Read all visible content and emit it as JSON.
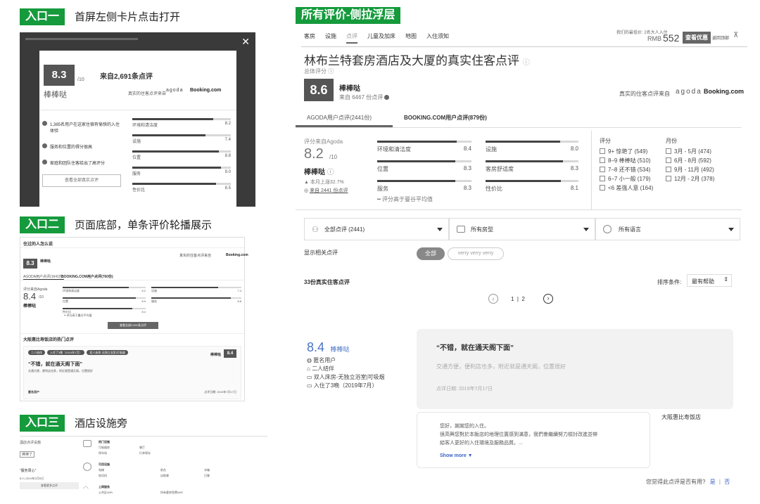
{
  "sections": {
    "s1": {
      "tag": "入口一",
      "caption": "首屏左侧卡片点击打开"
    },
    "s2": {
      "tag": "入口二",
      "caption": "页面底部，单条评价轮播展示"
    },
    "s3": {
      "tag": "入口三",
      "caption": "酒店设施旁"
    },
    "s4": {
      "tag": "所有评价-侧拉浮层"
    }
  },
  "p1": {
    "close": "✕",
    "score": "8.3",
    "outof": "/10",
    "rating": "棒棒哒",
    "reviews_from": "来自2,691条点评",
    "source_text": "真实的住客点评来自",
    "agoda": "agoda",
    "booking": "Booking.com",
    "highlights": [
      "1,385名用户在这家住宿有愉快的入住体验",
      "服务和位置的得分很高",
      "家庭和团队住客给出了高评分"
    ],
    "button": "查看全部真实点评",
    "bars": [
      {
        "label": "环境和清洁度",
        "value": "8.2",
        "pct": 82
      },
      {
        "label": "设施",
        "value": "7.4",
        "pct": 74
      },
      {
        "label": "位置",
        "value": "8.8",
        "pct": 88
      },
      {
        "label": "服务",
        "value": "9.0",
        "pct": 90
      },
      {
        "label": "性价比",
        "value": "8.5",
        "pct": 85
      }
    ]
  },
  "p2": {
    "title": "住过的人怎么说",
    "score": "8.3",
    "rating": "棒棒哒",
    "source": "真实的住客点评来自",
    "booking": "Booking.com",
    "tab1": "AGODA用户点评(1641份)",
    "tab2": "BOOKING.COM用户点评(760份)",
    "agoda_from": "评分来自Agoda",
    "score2": "8.4",
    "outof": "/10",
    "rating2": "棒棒哒",
    "bars": [
      {
        "label": "环境和清洁度",
        "value": "8.2"
      },
      {
        "label": "设施",
        "value": "7.4"
      },
      {
        "label": "位置",
        "value": "8.9"
      },
      {
        "label": "服务",
        "value": "8.8"
      },
      {
        "label": "性价比",
        "value": "8.4"
      }
    ],
    "avg_note": "━ 评分高于曼谷平均值",
    "view_all": "查看全部2,691条点评",
    "hot_title": "大阪惠比寿饭店的热门点评",
    "chips": [
      "二人结伴",
      "入住了3晚（2019年7月）",
      "双人床房-无独立浴室|可吸烟"
    ],
    "quote": "“不错，就在通天阁下面”",
    "quote_sub": "交通方便，便利店也多，附近就是通天阁，位置很好",
    "anon": "匿名用户",
    "date": "点评日期: 2019年7月17日",
    "right_rating": "棒棒哒",
    "right_score": "8.4"
  },
  "p3": {
    "head": "酒店点评设施",
    "rating": "棒棒了",
    "quote": "“服务周心”",
    "stay": "8.0 | 2019年2月9日",
    "btn": "查看更多点评",
    "cats": [
      {
        "title": "热门设施",
        "items": [
          "可吸烟房",
          "餐厅",
          "停车场",
          "行李寄存"
        ]
      },
      {
        "title": "可用设施",
        "items": [
          "电梯",
          "前台",
          "冰箱",
          "吹风机",
          "自助餐",
          "日餐"
        ]
      },
      {
        "title": "上网服务",
        "items": [
          "公共区WiFi",
          "所有客房免费WiFi"
        ]
      }
    ]
  },
  "p4": {
    "nav": [
      "客房",
      "设施",
      "点评",
      "儿童及加床",
      "地图",
      "入住须知"
    ],
    "price_label": "我们的最低价: 2名大人入住",
    "currency": "RMB",
    "price": "552",
    "cta": "查看优惠",
    "back_top": "返回顶部",
    "title": "林布兰特套房酒店及大厦的真实住客点评",
    "overall_label": "总体评分",
    "score": "8.6",
    "rating": "棒棒哒",
    "from_count": "来自 6467 份点评",
    "source": "真实的住客点评来自",
    "agoda": "agoda",
    "booking": "Booking.com",
    "tabs": [
      "AGODA用户点评(2441份)",
      "BOOKING.COM用户点评(879份)"
    ],
    "agoda_from": "评分来自Agoda",
    "score2": "8.2",
    "outof": "/10",
    "rating2": "棒棒哒",
    "trend": "▲ 本月上涨32.7%",
    "from2441": "来自 2441 份点评",
    "bars": [
      {
        "label": "环境和清洁度",
        "value": "8.4",
        "pct": 84
      },
      {
        "label": "设施",
        "value": "8.0",
        "pct": 80
      },
      {
        "label": "位置",
        "value": "8.3",
        "pct": 83
      },
      {
        "label": "客房舒适度",
        "value": "8.3",
        "pct": 83
      },
      {
        "label": "服务",
        "value": "8.3",
        "pct": 83
      },
      {
        "label": "性价比",
        "value": "8.1",
        "pct": 81
      }
    ],
    "avg_note": "━ 评分高于曼谷平均值",
    "score_filter_title": "评分",
    "score_filters": [
      "9+ 惊艳了 (549)",
      "8–9 棒棒哒 (510)",
      "7–8 还不错 (534)",
      "6–7 小一般 (179)",
      "<6 差强人意 (164)"
    ],
    "month_filter_title": "月份",
    "month_filters": [
      "3月 - 5月 (474)",
      "6月 - 8月 (592)",
      "9月 - 11月 (492)",
      "12月 - 2月 (378)"
    ],
    "dd1": "全部点评 (2441)",
    "dd2": "所有房型",
    "dd3": "所有语言",
    "related_label": "显示相关点评",
    "chip_all": "全部",
    "chip_vv": "verry verry verry",
    "count_label": "33份真实住客点评",
    "sort_label": "排序条件:",
    "sort_value": "最有帮助",
    "pager": "1  |  2",
    "review_score": "8.4",
    "review_rating": "棒棒哒",
    "reviewer": [
      "匿名用户",
      "二人结伴",
      "双人床房-无独立浴室|可吸烟",
      "入住了3晚（2019年7月）"
    ],
    "review_title": "“不错，就在通天阁下面”",
    "review_body": "交通方便，便利店也多，附近就是通天阁，位置很好",
    "review_date": "点评日期: 2019年7月17日",
    "hotel_name": "大阪惠比寿饭店",
    "reply": [
      "您好，謝謝您的入住。",
      "很高興您對於本飯店的地理位置感到滿意，我們會繼續努力檢討改進並帶",
      "給客人更好的入住環境及服務品質。..."
    ],
    "show_more": "Show more ▼",
    "helpful_q": "您觉得此点评是否有用?",
    "yes": "是",
    "no": "否"
  }
}
